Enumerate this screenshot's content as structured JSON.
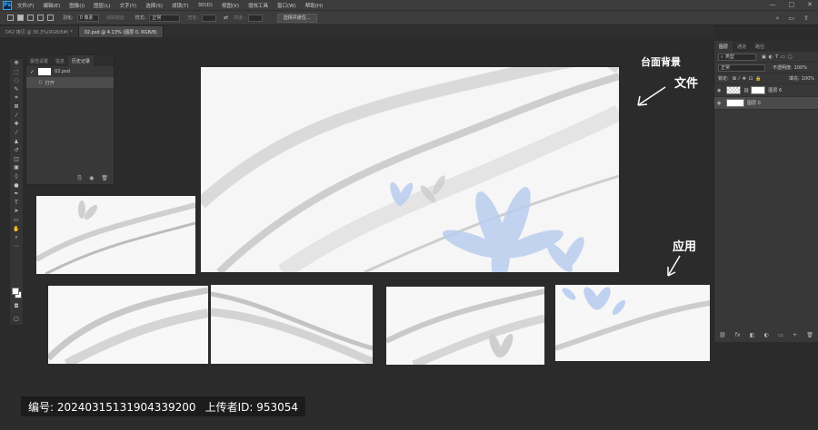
{
  "menubar": {
    "logo": "Ps",
    "items": [
      "文件(F)",
      "编辑(E)",
      "图像(I)",
      "图层(L)",
      "文字(Y)",
      "选择(S)",
      "滤镜(T)",
      "3D(D)",
      "视图(V)",
      "增效工具",
      "窗口(W)",
      "帮助(H)"
    ],
    "controls": [
      "—",
      "□",
      "✕"
    ]
  },
  "options": {
    "feather_label": "羽化:",
    "feather_value": "0 像素",
    "antialias_label": "消除锯齿",
    "style_label": "样式:",
    "style_value": "正常",
    "width_label": "宽度:",
    "height_label": "高度:",
    "select_mask_button": "选择并遮住..."
  },
  "tabs": [
    {
      "label": "D62 拷贝 @ 30.3%(RGB/8#) *",
      "active": false
    },
    {
      "label": "02.psd @ 4.13% (图层 0, RGB/8)",
      "active": true
    }
  ],
  "history_panel": {
    "tabs": [
      "属性设置",
      "信息",
      "历史记录"
    ],
    "active_tab": "历史记录",
    "snapshot": "02.psd",
    "items": [
      "打开"
    ]
  },
  "annotations": {
    "top": "台面背景",
    "top2": "文件",
    "bottom": "应用"
  },
  "layers_panel": {
    "tabs": [
      "图层",
      "通道",
      "路径"
    ],
    "kind_label": "类型",
    "blend_mode": "正常",
    "opacity_label": "不透明度:",
    "opacity_value": "100%",
    "lock_label": "锁定:",
    "fill_label": "填充:",
    "fill_value": "100%",
    "layers": [
      {
        "name": "图层 6",
        "selected": false,
        "checker": true
      },
      {
        "name": "图层 0",
        "selected": true,
        "checker": false
      }
    ],
    "bottom_icons": [
      "⛓",
      "fx",
      "◧",
      "◐",
      "▭",
      "+",
      "🗑"
    ]
  },
  "footer": {
    "id_label": "编号: 20240315131904339200",
    "uploader_label": "上传者ID: 953054"
  },
  "colors": {
    "workspace": "#2b2b2b",
    "panel": "#383838",
    "accent": "#31a8ff",
    "flower": "#b9cdf0"
  }
}
